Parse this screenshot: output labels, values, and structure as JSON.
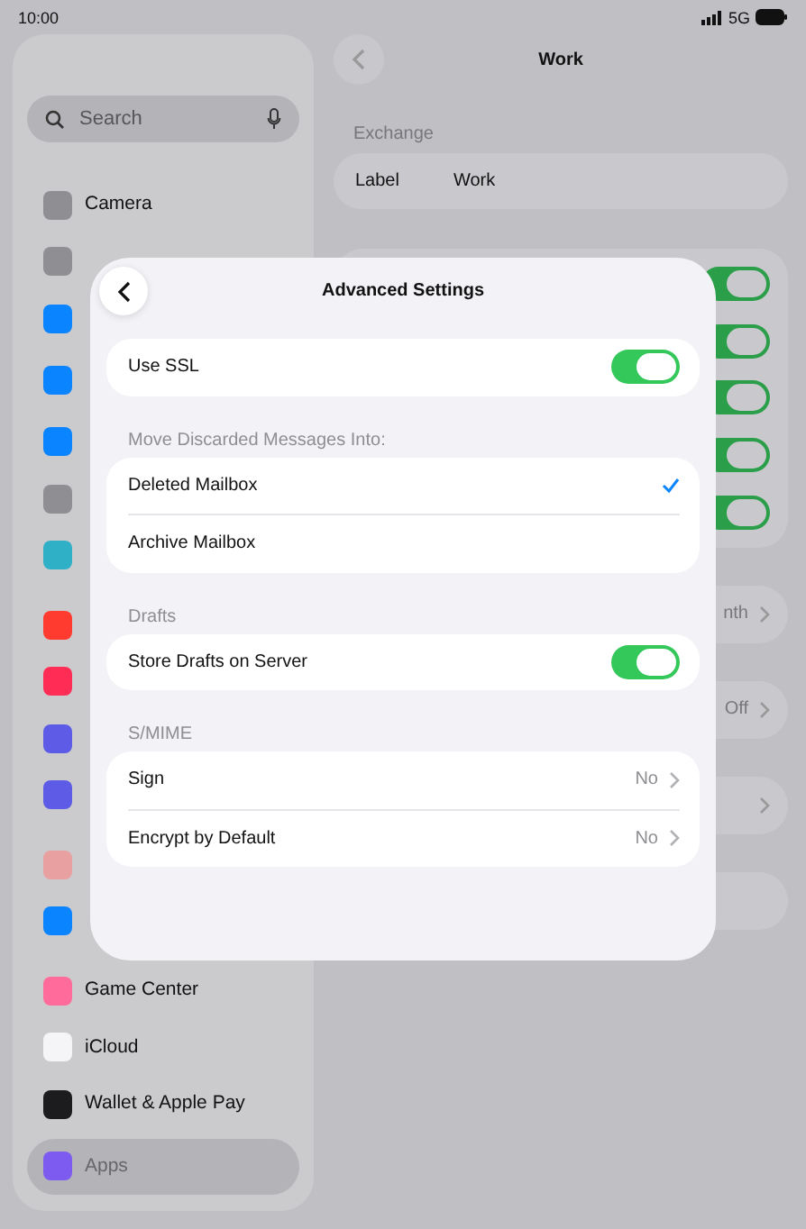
{
  "status_bar": {
    "time": "10:00",
    "network": "5G"
  },
  "sidebar": {
    "search_placeholder": "Search",
    "groups": [
      {
        "items": [
          {
            "label": "Camera",
            "color": "#8e8e93",
            "selected": false
          },
          {
            "color": "#8e8e93",
            "selected": false
          },
          {
            "color": "#0a84ff",
            "selected": false
          },
          {
            "kind": "tall",
            "color": "#0a84ff",
            "selected": false
          },
          {
            "color": "#0a84ff",
            "selected": false
          },
          {
            "color": "#8e8e93",
            "selected": false
          },
          {
            "color": "#30b0c7",
            "selected": false
          }
        ]
      },
      {
        "items": [
          {
            "color": "#ff3b30",
            "selected": false
          },
          {
            "color": "#ff2d55",
            "selected": false
          },
          {
            "color": "#5e5ce6",
            "selected": false
          },
          {
            "color": "#5e5ce6",
            "selected": false
          }
        ]
      },
      {
        "items": [
          {
            "color": "#e8a0a0",
            "selected": false
          },
          {
            "color": "#0a84ff",
            "selected": false
          }
        ]
      },
      {
        "items": [
          {
            "label": "Game Center",
            "color": "#ff6b9a",
            "selected": false
          },
          {
            "label": "iCloud",
            "color": "#f5f5f7",
            "selected": false
          },
          {
            "label": "Wallet & Apple Pay",
            "color": "#1c1c1e",
            "selected": false
          }
        ]
      },
      {
        "items": [
          {
            "label": "Apps",
            "color": "#7d5bf0",
            "selected": true
          }
        ]
      }
    ]
  },
  "detail": {
    "title": "Work",
    "section": "Exchange",
    "label_row": {
      "label": "Label",
      "value": "Work"
    },
    "toggles": [
      {
        "on": true
      },
      {
        "on": true
      },
      {
        "on": true
      },
      {
        "on": true
      },
      {
        "on": true
      }
    ],
    "rows": [
      {
        "kind": "value",
        "value": "nth"
      },
      {
        "kind": "value",
        "value": "Off"
      },
      {
        "kind": "chevron"
      },
      {
        "kind": "blank"
      }
    ]
  },
  "modal": {
    "title": "Advanced Settings",
    "sections": [
      {
        "rows": [
          {
            "kind": "toggle",
            "label": "Use SSL",
            "on": true
          }
        ]
      },
      {
        "header": "Move Discarded Messages Into:",
        "rows": [
          {
            "kind": "choice",
            "label": "Deleted Mailbox",
            "selected": true
          },
          {
            "kind": "choice",
            "label": "Archive Mailbox",
            "selected": false
          }
        ]
      },
      {
        "header": "Drafts",
        "rows": [
          {
            "kind": "toggle",
            "label": "Store Drafts on Server",
            "on": true
          }
        ]
      },
      {
        "header": "S/MIME",
        "rows": [
          {
            "kind": "link",
            "label": "Sign",
            "value": "No"
          },
          {
            "kind": "link",
            "label": "Encrypt by Default",
            "value": "No"
          }
        ]
      }
    ]
  }
}
